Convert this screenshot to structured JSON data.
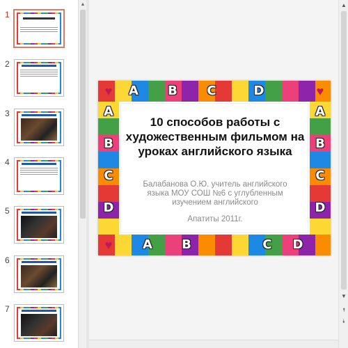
{
  "thumbnails": [
    {
      "number": "1",
      "active": true,
      "style": "title"
    },
    {
      "number": "2",
      "style": "text"
    },
    {
      "number": "3",
      "style": "photo"
    },
    {
      "number": "4",
      "style": "text"
    },
    {
      "number": "5",
      "style": "photo-dark"
    },
    {
      "number": "6",
      "style": "photo"
    },
    {
      "number": "7",
      "style": "photo-dark"
    }
  ],
  "slide": {
    "title": "10 способов работы с художественным фильмом на уроках английского языка",
    "subtitle": "Балабанова О.Ю. учитель английского языка  МОУ СОШ №6 с углубленным изучением английского",
    "city": "Апатиты  2011г."
  },
  "border_letters": [
    "A",
    "B",
    "C",
    "D"
  ],
  "colors": {
    "active_thumb_border": "#e07a5f",
    "active_number": "#c0392b",
    "canvas_bg": "#f4f4f4"
  },
  "icons": {
    "scroll_up": "▲",
    "scroll_down": "▼",
    "prev_slide": "⯭",
    "next_slide": "⯯"
  }
}
